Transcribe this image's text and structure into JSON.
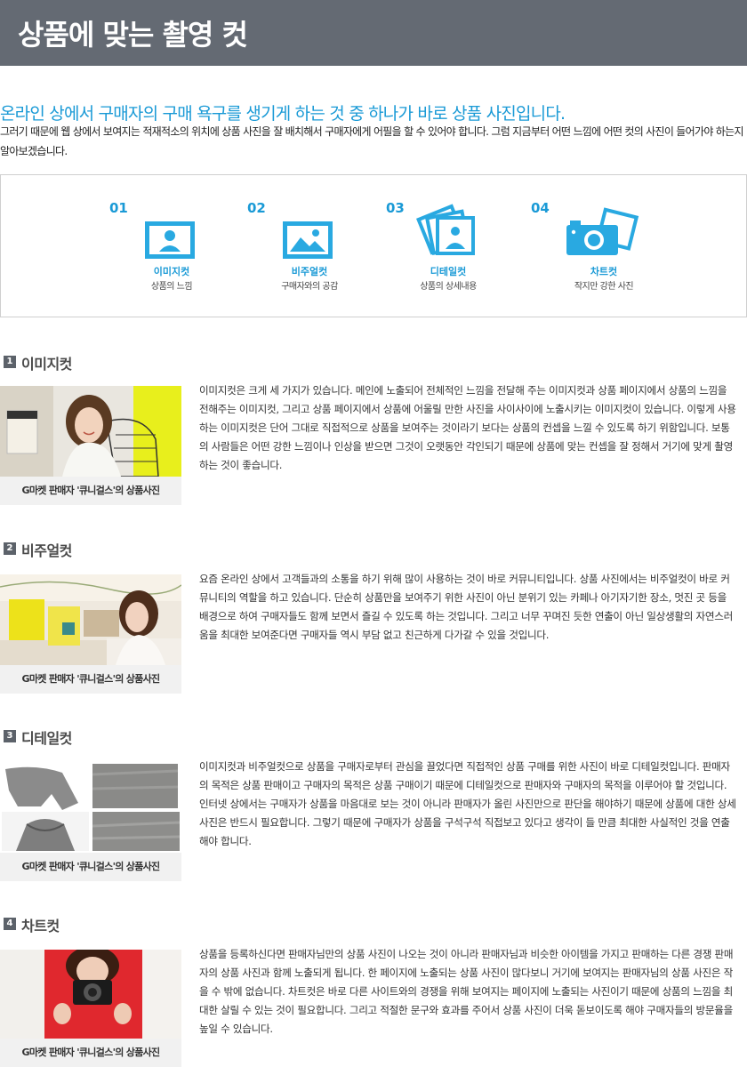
{
  "page": {
    "title": "상품에 맞는 촬영 컷",
    "headline": "온라인 상에서 구매자의 구매 욕구를 생기게 하는 것 중 하나가 바로 상품 사진입니다.",
    "intro": "그러기 때문에 웹 상에서 보여지는 적재적소의 위치에 상품 사진을 잘 배치해서 구매자에게 어필을 할 수 있어야 합니다. 그럼 지금부터 어떤 느낌에 어떤 컷의 사진이 들어가야 하는지 알아보겠습니다."
  },
  "steps": [
    {
      "num": "01",
      "title": "이미지컷",
      "desc": "상품의 느낌",
      "icon": "portrait-frame-icon"
    },
    {
      "num": "02",
      "title": "비주얼컷",
      "desc": "구매자와의 공감",
      "icon": "landscape-frame-icon"
    },
    {
      "num": "03",
      "title": "디테일컷",
      "desc": "상품의 상세내용",
      "icon": "stacked-photos-icon"
    },
    {
      "num": "04",
      "title": "차트컷",
      "desc": "작지만 강한 사진",
      "icon": "camera-icon"
    }
  ],
  "sections": [
    {
      "num": "1",
      "title": "이미지컷",
      "caption": "G마켓 판매자 '큐니걸스'의 상품사진",
      "text": "이미지컷은 크게 세 가지가 있습니다. 메인에 노출되어 전체적인 느낌을 전달해 주는 이미지컷과 상품 페이지에서 상품의 느낌을 전해주는 이미지컷, 그리고 상품 페이지에서 상품에 어울릴 만한 사진을 사이사이에 노출시키는 이미지컷이 있습니다. 이렇게 사용하는 이미지컷은 단어 그대로 직접적으로 상품을 보여주는 것이라기 보다는 상품의 컨셉을 느낄 수 있도록 하기 위함입니다. 보통의 사람들은 어떤 강한 느낌이나 인상을 받으면 그것이 오랫동안 각인되기 때문에 상품에 맞는 컨셉을 잘 정해서 거기에 맞게 촬영하는 것이 좋습니다."
    },
    {
      "num": "2",
      "title": "비주얼컷",
      "caption": "G마켓 판매자 '큐니걸스'의 상품사진",
      "text": "요즘 온라인 상에서 고객들과의 소통을 하기 위해 많이 사용하는 것이 바로 커뮤니티입니다. 상품 사진에서는 비주얼컷이 바로 커뮤니티의 역할을 하고 있습니다. 단순히 상품만을 보여주기 위한 사진이 아닌 분위기 있는 카페나 아기자기한 장소, 멋진 곳 등을 배경으로 하여 구매자들도 함께 보면서 즐길 수 있도록 하는 것입니다. 그리고 너무 꾸며진 듯한 연출이 아닌 일상생활의 자연스러움을 최대한 보여준다면 구매자들 역시 부담 없고 친근하게 다가갈 수 있을 것입니다."
    },
    {
      "num": "3",
      "title": "디테일컷",
      "caption": "G마켓 판매자 '큐니걸스'의 상품사진",
      "text": "이미지컷과 비주얼컷으로 상품을 구매자로부터 관심을 끌었다면 직접적인 상품 구매를 위한 사진이 바로 디테일컷입니다. 판매자의 목적은 상품 판매이고 구매자의 목적은 상품 구매이기 때문에 디테일컷으로 판매자와 구매자의 목적을 이루어야 할 것입니다. 인터넷 상에서는 구매자가 상품을 마음대로 보는 것이 아니라 판매자가 올린 사진만으로 판단을 해야하기 때문에 상품에 대한 상세 사진은 반드시 필요합니다. 그렇기 때문에 구매자가 상품을 구석구석 직접보고 있다고 생각이 들 만큼 최대한 사실적인 것을 연출해야 합니다."
    },
    {
      "num": "4",
      "title": "차트컷",
      "caption": "G마켓 판매자 '큐니걸스'의 상품사진",
      "text": "상품을 등록하신다면 판매자님만의 상품 사진이 나오는 것이 아니라 판매자님과 비슷한 아이템을 가지고 판매하는 다른 경쟁 판매자의 상품 사진과 함께 노출되게 됩니다. 한 페이지에 노출되는 상품 사진이 많다보니 거기에 보여지는 판매자님의 상품 사진은 작을 수 밖에 없습니다. 차트컷은 바로 다른 사이트와의 경쟁을 위해 보여지는 페이지에 노출되는 사진이기 때문에 상품의 느낌을 최대한 살릴 수 있는 것이 필요합니다. 그리고 적절한 문구와 효과를 주어서 상품 사진이 더욱 돋보이도록 해야 구매자들의 방문율을 높일 수 있습니다."
    }
  ],
  "colors": {
    "header_bg": "#646a73",
    "accent": "#1a9ad6",
    "section_num_bg": "#5c626a",
    "caption_bg": "#f1f1f1"
  }
}
